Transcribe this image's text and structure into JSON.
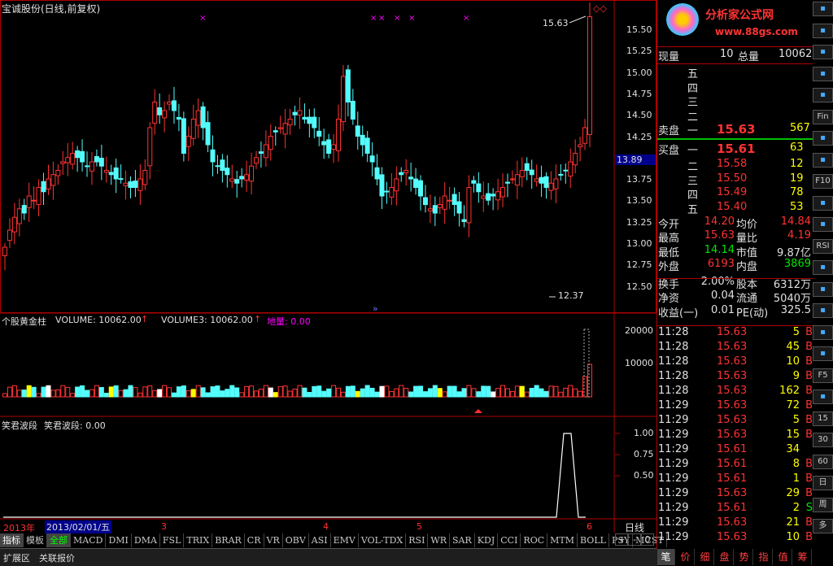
{
  "chart_header": {
    "title": "宝诚股份(日线,前复权)"
  },
  "price_axis": {
    "ticks": [
      "15.50",
      "15.25",
      "15.00",
      "14.75",
      "14.50",
      "14.25",
      "14.00",
      "13.75",
      "13.50",
      "13.25",
      "13.00",
      "12.75",
      "12.50"
    ],
    "current": "13.89",
    "high_label": "15.63",
    "low_label": "12.37"
  },
  "volume_panel": {
    "name": "个股黄金柱",
    "vol_label": "VOLUME: 10062.00",
    "vol3_label": "VOLUME3: 10062.00",
    "dl_label": "地量: 0.00",
    "ticks": [
      "20000",
      "10000"
    ]
  },
  "indicator_panel": {
    "name": "笑君波段",
    "value_label": "笑君波段: 0.00",
    "ticks": [
      "1.00",
      "0.75",
      "0.50"
    ]
  },
  "date_axis": {
    "year": "2013年",
    "cursor_date": "2013/02/01/五",
    "months": [
      "3",
      "4",
      "5",
      "6"
    ],
    "period": "日线"
  },
  "tabs": {
    "items": [
      "指标",
      "模板",
      "全部",
      "MACD",
      "DMI",
      "DMA",
      "FSL",
      "TRIX",
      "BRAR",
      "CR",
      "VR",
      "OBV",
      "ASI",
      "EMV",
      "VOL-TDX",
      "RSI",
      "WR",
      "SAR",
      "KDJ",
      "CCI",
      "ROC",
      "MTM",
      "BOLL",
      "PSY",
      "MCST"
    ],
    "ctrl": [
      "+",
      "-",
      "0"
    ]
  },
  "bottom_tabs": {
    "ext": "扩展区",
    "quote": "关联报价"
  },
  "logo": {
    "text": "分析家公式网",
    "url": "www.88gs.com"
  },
  "quote": {
    "cur_vol_label": "现量",
    "cur_vol": "10",
    "total_vol_label": "总量",
    "total_vol": "10062",
    "sell_label": "卖盘",
    "buy_label": "买盘",
    "sell_levels": [
      {
        "lvl": "五",
        "price": "",
        "vol": ""
      },
      {
        "lvl": "四",
        "price": "",
        "vol": ""
      },
      {
        "lvl": "三",
        "price": "",
        "vol": ""
      },
      {
        "lvl": "二",
        "price": "",
        "vol": ""
      },
      {
        "lvl": "一",
        "price": "15.63",
        "vol": "567"
      }
    ],
    "buy_levels": [
      {
        "lvl": "一",
        "price": "15.61",
        "vol": "63"
      },
      {
        "lvl": "二",
        "price": "15.58",
        "vol": "12"
      },
      {
        "lvl": "三",
        "price": "15.50",
        "vol": "19"
      },
      {
        "lvl": "四",
        "price": "15.49",
        "vol": "78"
      },
      {
        "lvl": "五",
        "price": "15.40",
        "vol": "53"
      }
    ],
    "stats": [
      [
        {
          "k": "今开",
          "v": "14.20",
          "c": "red"
        },
        {
          "k": "均价",
          "v": "14.84",
          "c": "red"
        }
      ],
      [
        {
          "k": "最高",
          "v": "15.63",
          "c": "red"
        },
        {
          "k": "量比",
          "v": "4.19",
          "c": "red"
        }
      ],
      [
        {
          "k": "最低",
          "v": "14.14",
          "c": "green"
        },
        {
          "k": "市值",
          "v": "9.87亿",
          "c": "white"
        }
      ],
      [
        {
          "k": "外盘",
          "v": "6193",
          "c": "red"
        },
        {
          "k": "内盘",
          "v": "3869",
          "c": "green"
        }
      ],
      [
        {
          "k": "换手",
          "v": "2.00%",
          "c": "white"
        },
        {
          "k": "股本",
          "v": "6312万",
          "c": "white"
        }
      ],
      [
        {
          "k": "净资",
          "v": "0.04",
          "c": "white"
        },
        {
          "k": "流通",
          "v": "5040万",
          "c": "white"
        }
      ],
      [
        {
          "k": "收益(一)",
          "v": "0.01",
          "c": "white"
        },
        {
          "k": "PE(动)",
          "v": "325.5",
          "c": "white"
        }
      ]
    ],
    "ticks": [
      {
        "t": "11:28",
        "p": "15.63",
        "v": "5",
        "s": "B"
      },
      {
        "t": "11:28",
        "p": "15.63",
        "v": "45",
        "s": "B"
      },
      {
        "t": "11:28",
        "p": "15.63",
        "v": "10",
        "s": "B"
      },
      {
        "t": "11:28",
        "p": "15.63",
        "v": "9",
        "s": "B"
      },
      {
        "t": "11:28",
        "p": "15.63",
        "v": "162",
        "s": "B"
      },
      {
        "t": "11:29",
        "p": "15.63",
        "v": "72",
        "s": "B"
      },
      {
        "t": "11:29",
        "p": "15.63",
        "v": "5",
        "s": "B"
      },
      {
        "t": "11:29",
        "p": "15.63",
        "v": "15",
        "s": "B"
      },
      {
        "t": "11:29",
        "p": "15.61",
        "v": "34",
        "s": ""
      },
      {
        "t": "11:29",
        "p": "15.61",
        "v": "8",
        "s": "B"
      },
      {
        "t": "11:29",
        "p": "15.61",
        "v": "1",
        "s": "B"
      },
      {
        "t": "11:29",
        "p": "15.63",
        "v": "29",
        "s": "B"
      },
      {
        "t": "11:29",
        "p": "15.61",
        "v": "2",
        "s": "S"
      },
      {
        "t": "11:29",
        "p": "15.63",
        "v": "21",
        "s": "B"
      },
      {
        "t": "11:29",
        "p": "15.63",
        "v": "10",
        "s": "B"
      }
    ],
    "bottom_tabs": [
      "笔",
      "价",
      "细",
      "盘",
      "势",
      "指",
      "值",
      "筹"
    ]
  },
  "right_toolbar": [
    "",
    "",
    "",
    "",
    "",
    "Fin",
    "",
    "",
    "F10",
    "",
    "",
    "RSI",
    "",
    "",
    "",
    "",
    "",
    "F5",
    "",
    "15",
    "30",
    "60",
    "日",
    "周",
    "多"
  ],
  "chart_data": {
    "type": "candlestick",
    "high": 15.63,
    "low": 12.37,
    "last": 13.89
  }
}
